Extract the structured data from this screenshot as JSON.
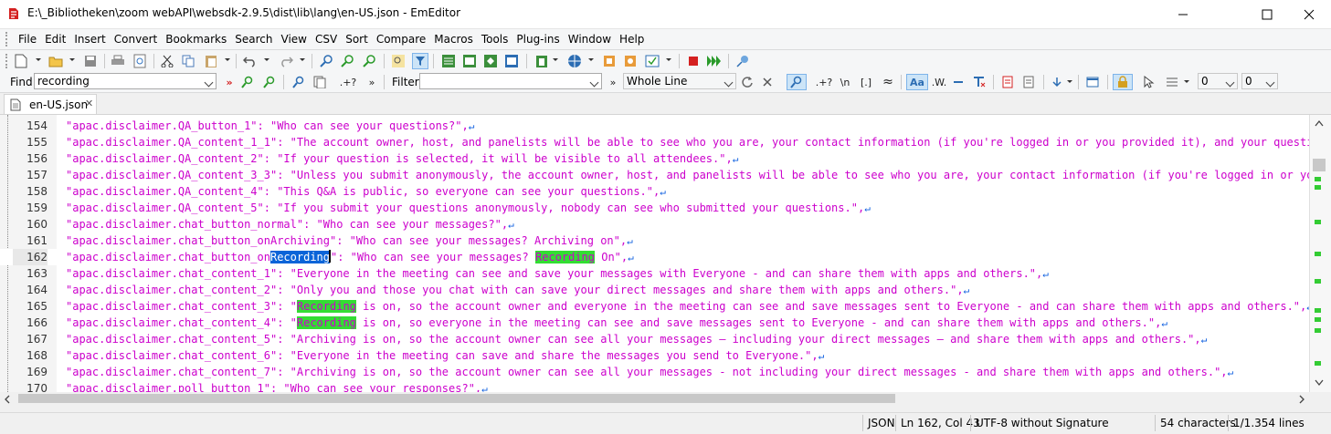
{
  "window": {
    "title": "E:\\_Bibliotheken\\zoom webAPI\\websdk-2.9.5\\dist\\lib\\lang\\en-US.json - EmEditor"
  },
  "menu": [
    "File",
    "Edit",
    "Insert",
    "Convert",
    "Bookmarks",
    "Search",
    "View",
    "CSV",
    "Sort",
    "Compare",
    "Macros",
    "Tools",
    "Plug-ins",
    "Window",
    "Help"
  ],
  "findbar": {
    "find_label": "Find",
    "find_value": "recording",
    "regex_label": ".+?",
    "filter_label": "Filter",
    "filter_value": "",
    "mode_value": "Whole Line",
    "regex_label2": ".+?",
    "newline_label": "\\n",
    "bracket_label": "[.]",
    "case_label": "Aa",
    "word_label": ".W.",
    "num1": "0",
    "num2": "0"
  },
  "tab": {
    "label": "en-US.json"
  },
  "editor": {
    "current_line": 162,
    "search_term": "Recording",
    "colors": {
      "text": "#cc00cc",
      "highlight": "#33dd33",
      "selection": "#0a64d8",
      "return_mark": "#1060e0"
    },
    "lines": [
      {
        "n": "154",
        "text": "\"apac.disclaimer.QA_button_1\": \"Who can see your questions?\","
      },
      {
        "n": "155",
        "text": "\"apac.disclaimer.QA_content_1_1\": \"The account owner, host, and panelists will be able to see who you are, your contact information (if you're logged in or you provided it), and your question"
      },
      {
        "n": "156",
        "text": "\"apac.disclaimer.QA_content_2\": \"If your question is selected, it will be visible to all attendees.\","
      },
      {
        "n": "157",
        "text": "\"apac.disclaimer.QA_content_3_3\": \"Unless you submit anonymously, the account owner, host, and panelists will be able to see who you are, your contact information (if you're logged in or you"
      },
      {
        "n": "158",
        "text": "\"apac.disclaimer.QA_content_4\": \"This Q&A is public, so everyone can see your questions.\","
      },
      {
        "n": "159",
        "text": "\"apac.disclaimer.QA_content_5\": \"If you submit your questions anonymously, nobody can see who submitted your questions.\","
      },
      {
        "n": "160",
        "text": "\"apac.disclaimer.chat_button_normal\": \"Who can see your messages?\","
      },
      {
        "n": "161",
        "text": "\"apac.disclaimer.chat_button_onArchiving\": \"Who can see your messages? Archiving on\","
      },
      {
        "n": "162",
        "pre": "\"apac.disclaimer.chat_button_on",
        "sel": "Recording",
        "mid": "\": \"Who can see your messages? ",
        "hl": "Recording",
        "post": " On\","
      },
      {
        "n": "163",
        "text": "\"apac.disclaimer.chat_content_1\": \"Everyone in the meeting can see and save your messages with Everyone - and can share them with apps and others.\","
      },
      {
        "n": "164",
        "text": "\"apac.disclaimer.chat_content_2\": \"Only you and those you chat with can save your direct messages and share them with apps and others.\","
      },
      {
        "n": "165",
        "pre": "\"apac.disclaimer.chat_content_3\": \"",
        "hl": "Recording",
        "post": " is on, so the account owner and everyone in the meeting can see and save messages sent to Everyone - and can share them with apps and others.\","
      },
      {
        "n": "166",
        "pre": "\"apac.disclaimer.chat_content_4\": \"",
        "hl": "Recording",
        "post": " is on, so everyone in the meeting can see and save messages sent to Everyone - and can share them with apps and others.\","
      },
      {
        "n": "167",
        "text": "\"apac.disclaimer.chat_content_5\": \"Archiving is on, so the account owner can see all your messages — including your direct messages — and share them with apps and others.\","
      },
      {
        "n": "168",
        "text": "\"apac.disclaimer.chat_content_6\": \"Everyone in the meeting can save and share the messages you send to Everyone.\","
      },
      {
        "n": "169",
        "text": "\"apac.disclaimer.chat_content_7\": \"Archiving is on, so the account owner can see all your messages - not including your direct messages - and share them with apps and others.\","
      },
      {
        "n": "170",
        "text": "\"apac.disclaimer.poll_button_1\": \"Who can see your responses?\","
      }
    ]
  },
  "status": {
    "format": "JSON",
    "position": "Ln 162, Col 43",
    "encoding": "UTF-8 without Signature",
    "chars": "54 characters",
    "lines": "1/1.354 lines"
  }
}
